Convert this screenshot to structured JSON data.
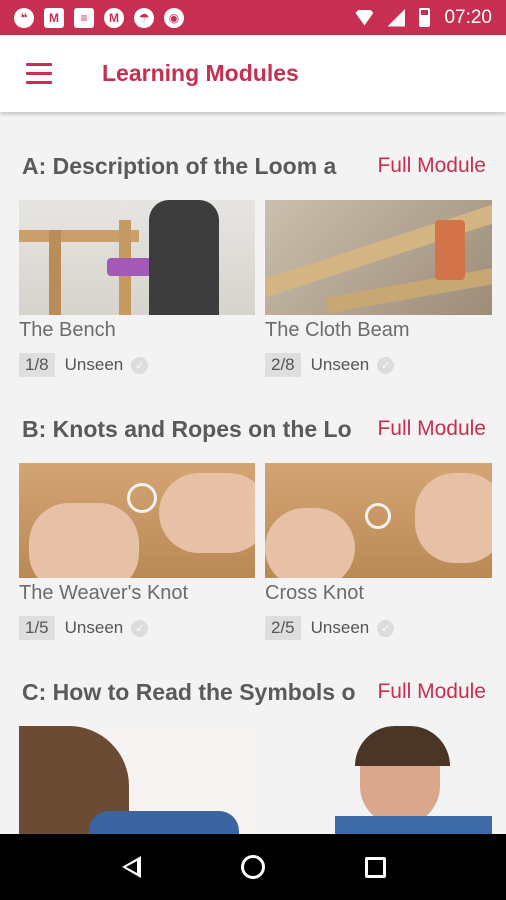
{
  "status_bar": {
    "time": "07:20",
    "icons": [
      "hangouts-icon",
      "gmail-icon",
      "news-icon",
      "motorola-icon",
      "umbrella-icon",
      "chrome-icon"
    ]
  },
  "app_bar": {
    "title": "Learning Modules"
  },
  "modules": [
    {
      "title": "A: Description of the Loom a",
      "link": "Full Module",
      "cards": [
        {
          "title": "The Bench",
          "index": "1/8",
          "status": "Unseen"
        },
        {
          "title": "The Cloth Beam",
          "index": "2/8",
          "status": "Unseen"
        }
      ]
    },
    {
      "title": "B: Knots and Ropes on the Lo",
      "link": "Full Module",
      "cards": [
        {
          "title": "The Weaver's Knot",
          "index": "1/5",
          "status": "Unseen"
        },
        {
          "title": "Cross Knot",
          "index": "2/5",
          "status": "Unseen"
        }
      ]
    },
    {
      "title": "C: How to Read the Symbols o",
      "link": "Full Module"
    }
  ],
  "colors": {
    "accent": "#c62f52",
    "status_bar": "#c62f52",
    "background": "#f3f3f3"
  }
}
